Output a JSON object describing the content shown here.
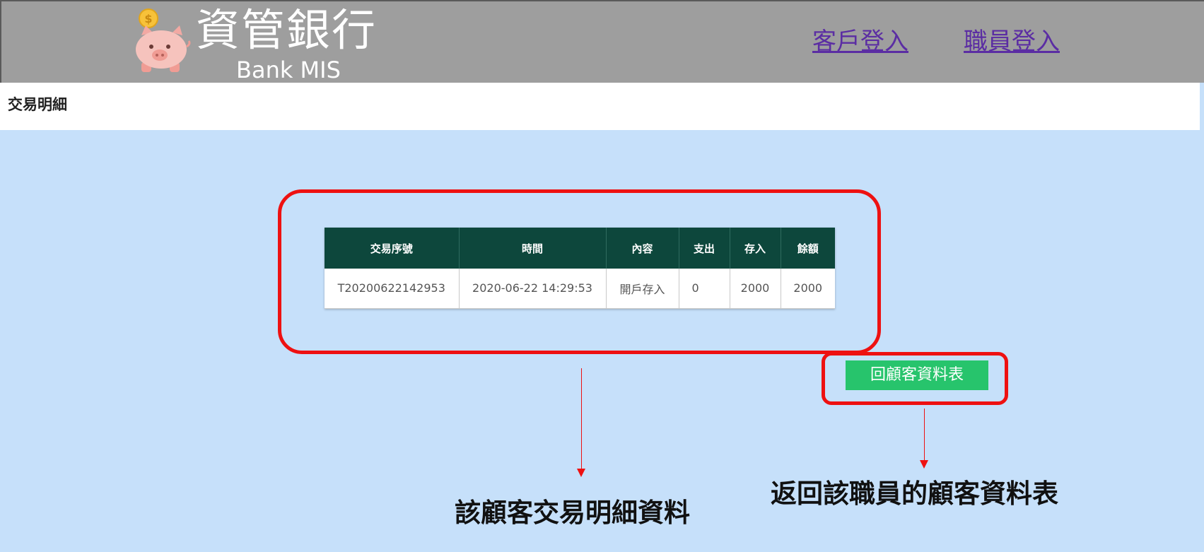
{
  "header": {
    "brand_title": "資管銀行",
    "brand_subtitle": "Bank MIS",
    "logo_icon": "piggy-bank-coin-icon",
    "nav": {
      "customer_login": "客戶登入",
      "staff_login": "職員登入"
    }
  },
  "page": {
    "title": "交易明細"
  },
  "table": {
    "headers": [
      "交易序號",
      "時間",
      "內容",
      "支出",
      "存入",
      "餘額"
    ],
    "rows": [
      [
        "T20200622142953",
        "2020-06-22 14:29:53",
        "開戶存入",
        "0",
        "2000",
        "2000"
      ]
    ]
  },
  "back_button": {
    "label": "回顧客資料表"
  },
  "annotations": {
    "table_label": "該顧客交易明細資料",
    "button_label": "返回該職員的顧客資料表",
    "highlight_color": "#ee1111"
  },
  "colors": {
    "header_bg": "#9e9e9e",
    "page_bg": "#c6e0fa",
    "table_header_bg": "#0d473c",
    "button_bg": "#27c46c",
    "link_color": "#5b2da3"
  }
}
